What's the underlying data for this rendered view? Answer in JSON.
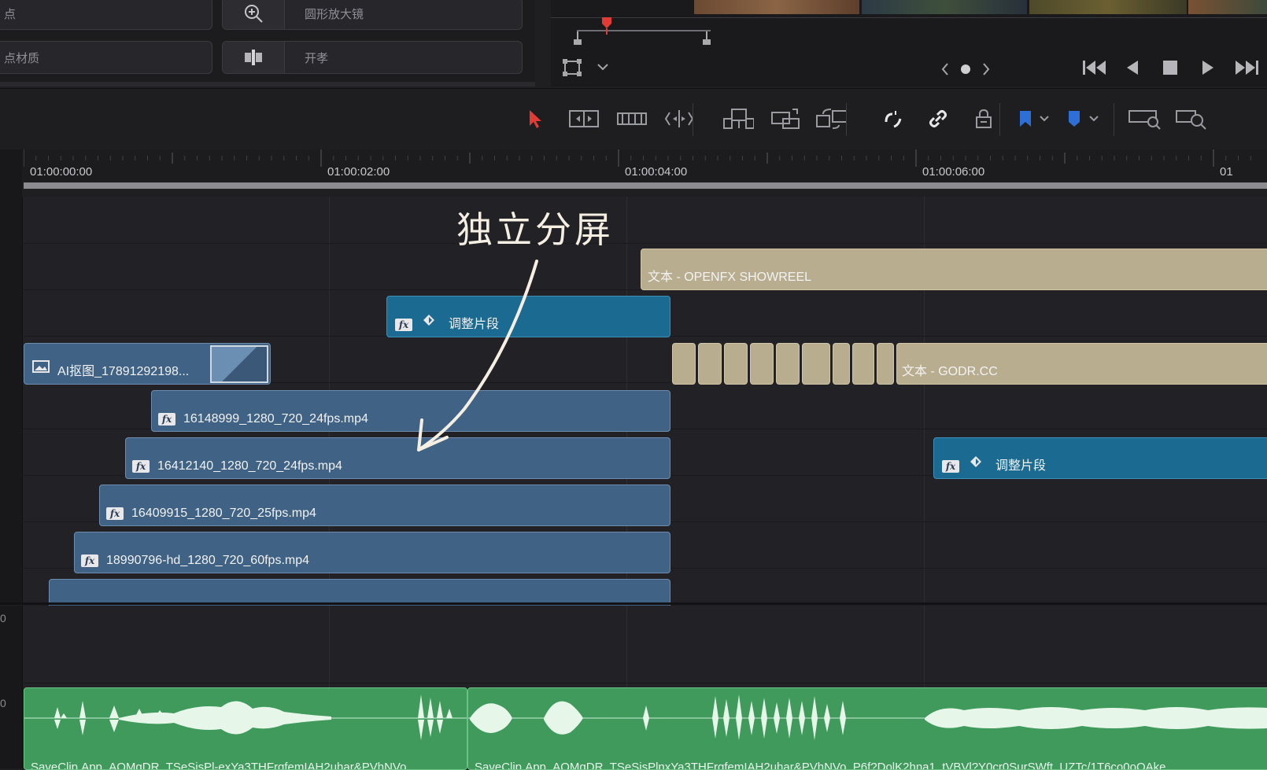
{
  "effects": [
    {
      "label": "点",
      "icon": "dot-icon"
    },
    {
      "label": "圆形放大镜",
      "icon": "zoom-in-icon"
    },
    {
      "label": "点材质",
      "icon": "texture-icon"
    },
    {
      "label": "开孝",
      "icon": "split-icon"
    }
  ],
  "ruler": {
    "timecodes": [
      "01:00:00:00",
      "01:00:02:00",
      "01:00:04:00",
      "01:00:06:00",
      "01"
    ]
  },
  "annotation": "独立分屏",
  "clips": {
    "text_openfx": "文本 - OPENFX SHOWREEL",
    "adjust_1": "调整片段",
    "image_clip": "AI抠图_17891292198...",
    "text_godr": "文本 - GODR.CC",
    "video_1": "16148999_1280_720_24fps.mp4",
    "video_2": "16412140_1280_720_24fps.mp4",
    "adjust_2": "调整片段",
    "video_3": "16409915_1280_720_25fps.mp4",
    "video_4": "18990796-hd_1280_720_60fps.mp4"
  },
  "fx_badge": "fx",
  "audio": {
    "clip_1": "SaveClip.App_AQMqDR_TSeSisPl-exYa3THFrgfemIAH2uhar&PVhNVo",
    "clip_2": "SaveClip.App_AQMqDR_TSeSisPlnxYa3THFrgfemIAH2uhar&PVhNVo_P6f?DolK2hna1_tVBVl?Y0cr0SurSWft_UZTc/1T6co0oQAke"
  },
  "track_numbers": [
    "0",
    "0"
  ],
  "colors": {
    "video": "#3f6285",
    "adjust": "#1b6a92",
    "text": "#b8ad8f",
    "audio": "#3f9a5c",
    "playhead": "#e23b35"
  }
}
